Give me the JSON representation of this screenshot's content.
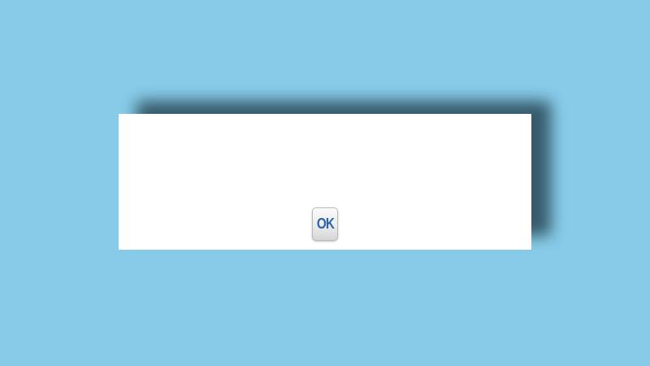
{
  "dialog": {
    "ok_label": "OK"
  },
  "colors": {
    "background": "#87cbe8",
    "dialog_background": "#ffffff",
    "ok_text": "#2a66a8"
  }
}
